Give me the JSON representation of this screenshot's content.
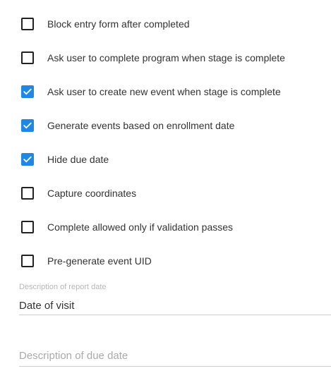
{
  "checkboxes": [
    {
      "label": "Block entry form after completed",
      "checked": false
    },
    {
      "label": "Ask user to complete program when stage is complete",
      "checked": false
    },
    {
      "label": "Ask user to create new event when stage is complete",
      "checked": true
    },
    {
      "label": "Generate events based on enrollment date",
      "checked": true
    },
    {
      "label": "Hide due date",
      "checked": true
    },
    {
      "label": "Capture coordinates",
      "checked": false
    },
    {
      "label": "Complete allowed only if validation passes",
      "checked": false
    },
    {
      "label": "Pre-generate event UID",
      "checked": false
    }
  ],
  "report_date_field": {
    "label": "Description of report date",
    "value": "Date of visit"
  },
  "due_date_field": {
    "placeholder": "Description of due date",
    "value": ""
  },
  "colors": {
    "checked_fill": "#1e88e5",
    "unchecked_border": "#222222"
  },
  "icons": {
    "check": "checkmark-icon"
  }
}
